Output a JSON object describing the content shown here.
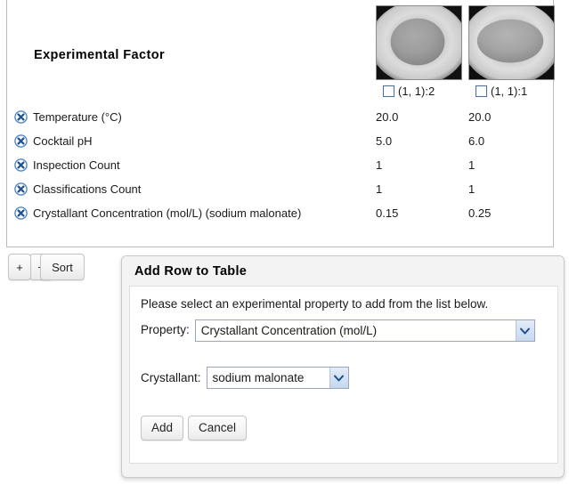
{
  "table": {
    "header_title": "Experimental Factor",
    "columns": [
      {
        "checkbox_label": "(1, 1):2",
        "checked": false,
        "thumbnail": "drop-image-round"
      },
      {
        "checkbox_label": "(1, 1):1",
        "checked": false,
        "thumbnail": "drop-image-oval"
      }
    ],
    "rows": [
      {
        "delete_icon": "delete-circle-x-icon",
        "label": "Temperature (°C)",
        "values": [
          "20.0",
          "20.0"
        ]
      },
      {
        "delete_icon": "delete-circle-x-icon",
        "label": "Cocktail pH",
        "values": [
          "5.0",
          "6.0"
        ]
      },
      {
        "delete_icon": "delete-circle-x-icon",
        "label": "Inspection Count",
        "values": [
          "1",
          "1"
        ]
      },
      {
        "delete_icon": "delete-circle-x-icon",
        "label": "Classifications Count",
        "values": [
          "1",
          "1"
        ]
      },
      {
        "delete_icon": "delete-circle-x-icon",
        "label": "Crystallant Concentration (mol/L) (sodium malonate)",
        "values": [
          "0.15",
          "0.25"
        ]
      }
    ]
  },
  "toolbar": {
    "add_row_label": "+",
    "remove_row_label": "−",
    "sort_label": "Sort"
  },
  "dialog": {
    "title": "Add Row to Table",
    "instructions": "Please select an experimental property to add from the list below.",
    "property_field": {
      "label": "Property:",
      "selected": "Crystallant Concentration (mol/L)"
    },
    "crystallant_field": {
      "label": "Crystallant:",
      "selected": "sodium malonate"
    },
    "add_label": "Add",
    "cancel_label": "Cancel"
  },
  "colors": {
    "accent_blue": "#2a63a8",
    "checkbox_border": "#4a6f9c",
    "panel_border": "#bcbcbc",
    "dialog_bg": "#f3f3f3"
  }
}
